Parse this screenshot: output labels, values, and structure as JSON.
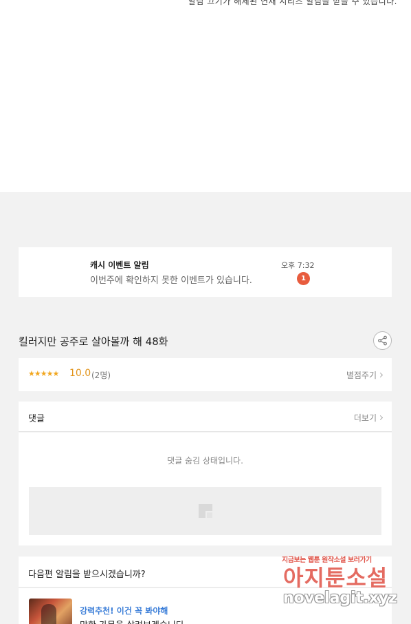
{
  "top": {
    "cut_text": "알림 끄기가 해제된 연재 시리즈 알림을 받을 수 있습니다."
  },
  "notification": {
    "title": "캐시 이벤트 알림",
    "body": "이번주에 확인하지 못한 이벤트가 있습니다.",
    "time": "오후 7:32",
    "badge": "1"
  },
  "episode": {
    "title": "킬러지만 공주로 살아볼까 해 48화",
    "share_icon": "share-icon"
  },
  "rating": {
    "stars": "★★★★★",
    "score": "10.0",
    "count": "(2명)",
    "rate_label": "별점주기"
  },
  "comments": {
    "label": "댓글",
    "more_label": "더보기",
    "hidden_message": "댓글 숨김 상태입니다."
  },
  "next_alarm": {
    "label": "다음편 알림을 받으시겠습니까?",
    "recommend_tag": "강력추천! 이건 꼭 봐야해",
    "recommend_title": "망한 가문을 살려보겠습니다"
  },
  "watermark": {
    "top_text": "지금보는 웹툰 원작소설 보러가기",
    "main_text": "아지툰소설",
    "url": "novelagit.xyz"
  },
  "colors": {
    "accent_orange": "#e2941b",
    "badge_red": "#e85c3e",
    "link_blue": "#3b7ed8"
  }
}
